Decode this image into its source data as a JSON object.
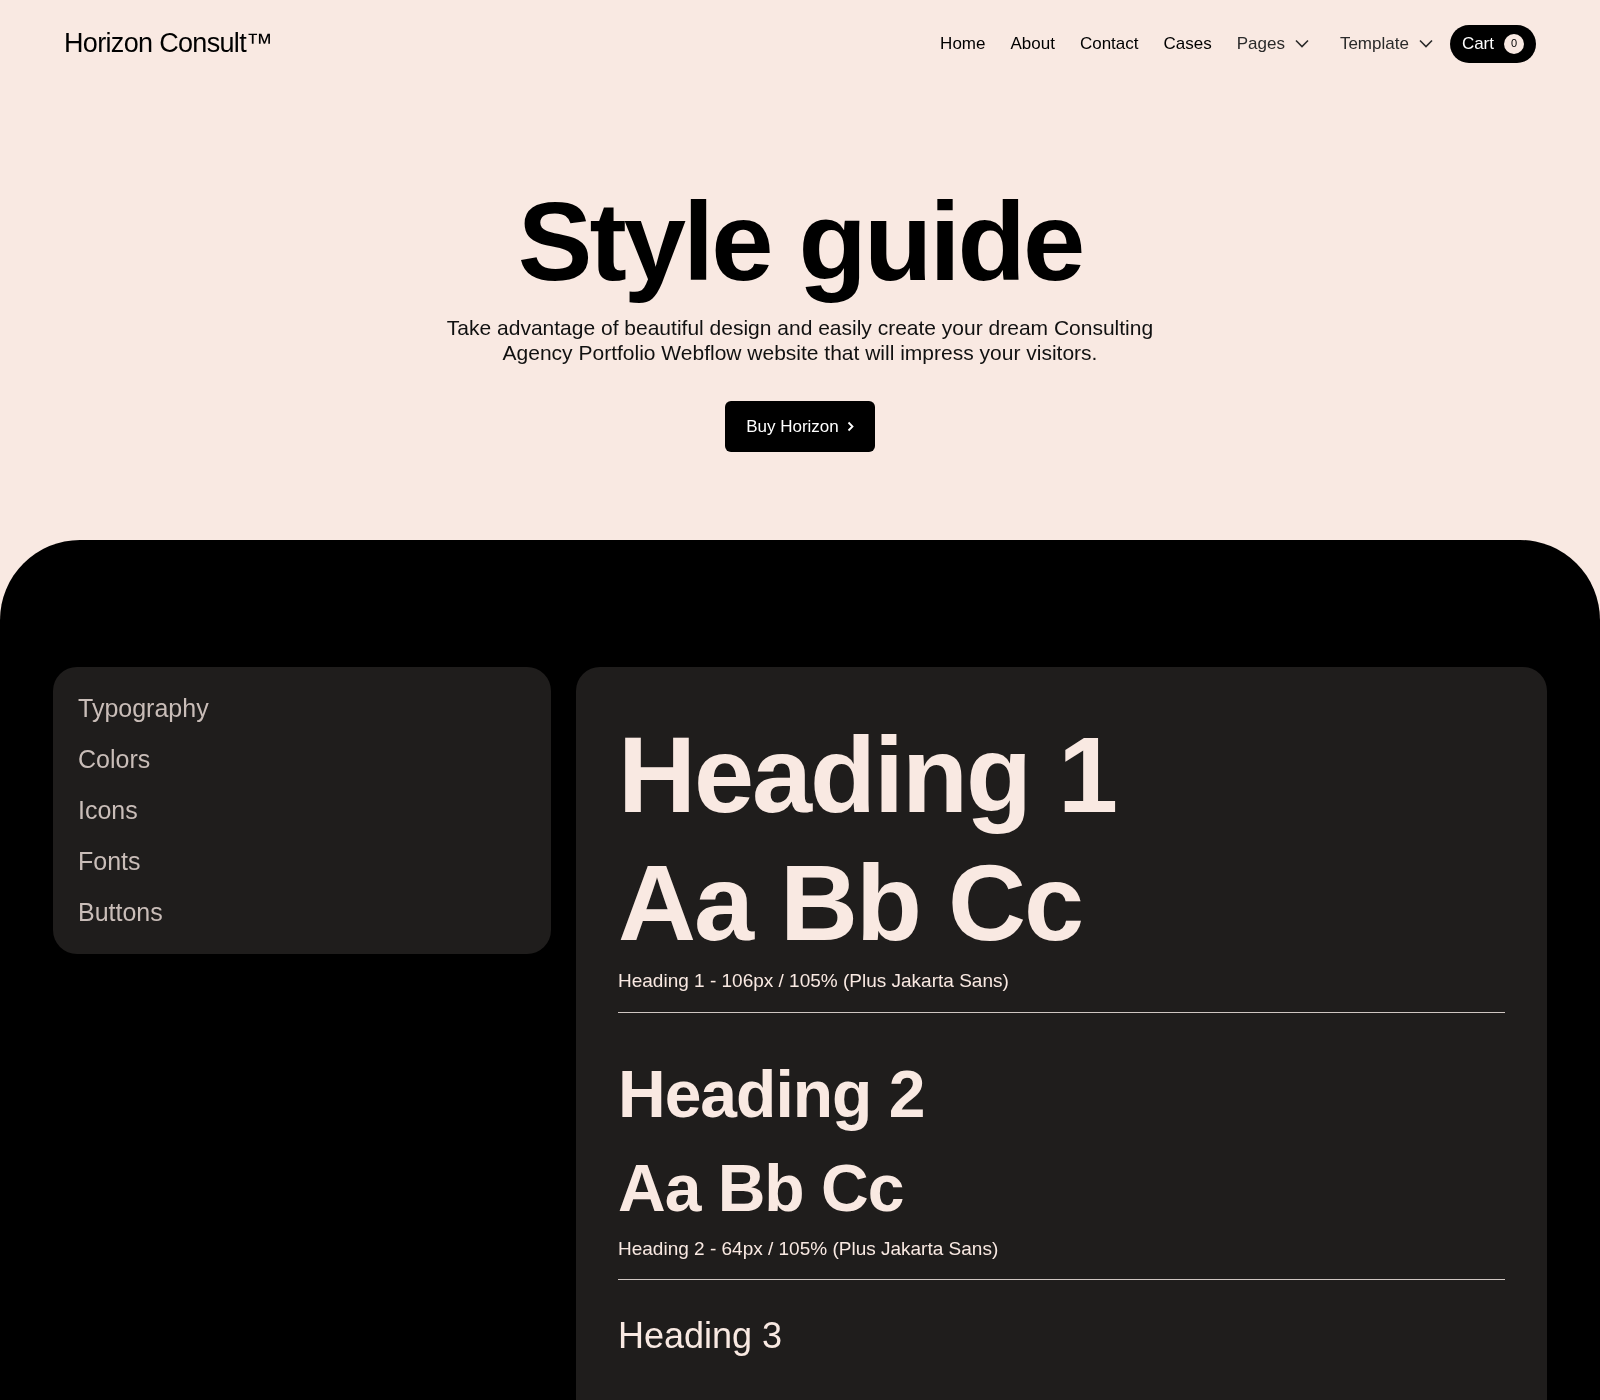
{
  "header": {
    "logo": "Horizon Consult™",
    "nav": [
      {
        "label": "Home",
        "kind": "link"
      },
      {
        "label": "About",
        "kind": "link"
      },
      {
        "label": "Contact",
        "kind": "link"
      },
      {
        "label": "Cases",
        "kind": "link"
      },
      {
        "label": "Pages",
        "kind": "dropdown"
      },
      {
        "label": "Template",
        "kind": "dropdown"
      }
    ],
    "cart": {
      "label": "Cart",
      "count": "0"
    }
  },
  "hero": {
    "title": "Style guide",
    "subtitle": "Take advantage of beautiful design and easily create your dream Consulting Agency Portfolio Webflow website that will impress your visitors.",
    "button": "Buy Horizon"
  },
  "sidebar": {
    "items": [
      "Typography",
      "Colors",
      "Icons",
      "Fonts",
      "Buttons"
    ]
  },
  "specimens": [
    {
      "kind": "h1",
      "heading": "Heading 1",
      "sample": "Aa Bb Cc",
      "caption": "Heading 1 - 106px / 105% (Plus Jakarta Sans)"
    },
    {
      "kind": "h2",
      "heading": "Heading 2",
      "sample": "Aa Bb Cc",
      "caption": "Heading 2 - 64px / 105% (Plus Jakarta Sans)"
    },
    {
      "kind": "h3",
      "heading": "Heading 3"
    }
  ]
}
